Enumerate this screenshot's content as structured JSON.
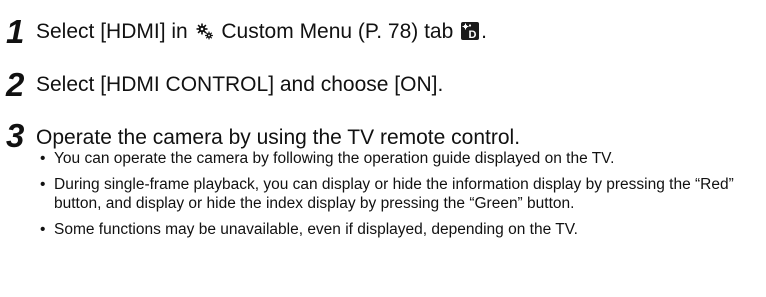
{
  "steps": [
    {
      "number": "1",
      "text_before": "Select [HDMI] in ",
      "icon1": "gear-custom-menu-icon",
      "text_middle": " Custom Menu (P. 78) tab ",
      "icon2": "custom-menu-tab-d-icon",
      "icon2_letter": "D",
      "text_after": "."
    },
    {
      "number": "2",
      "text": "Select [HDMI CONTROL] and choose [ON]."
    },
    {
      "number": "3",
      "text": "Operate the camera by using the TV remote control.",
      "bullet_symbol": "•",
      "bullets": [
        "You can operate the camera by following the operation guide displayed on the TV.",
        "During single-frame playback, you can display or hide the information display by pressing the “Red” button, and display or hide the index display by pressing the “Green” button.",
        "Some functions may be unavailable, even if displayed, depending on the TV."
      ]
    }
  ]
}
